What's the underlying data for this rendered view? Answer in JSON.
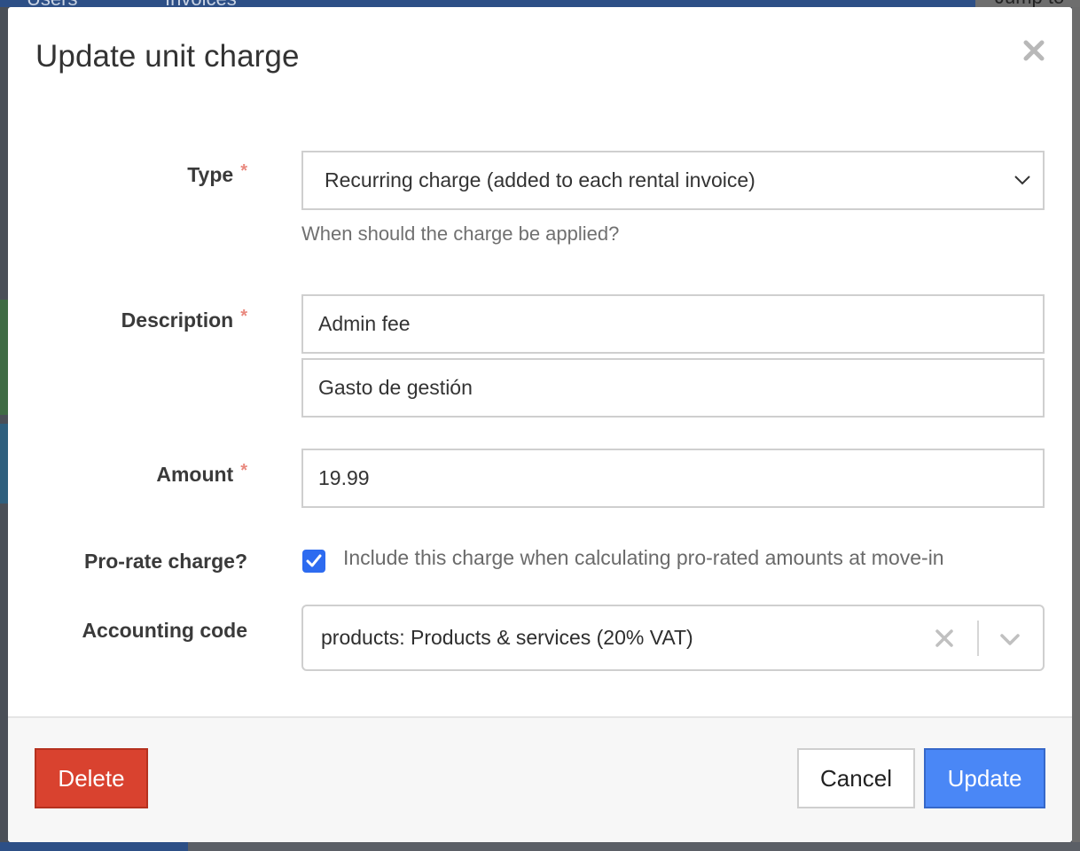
{
  "background": {
    "tabs": [
      "Users",
      "Invoices"
    ],
    "jump_label": "Jump to"
  },
  "modal": {
    "title": "Update unit charge",
    "close_icon": "close-icon"
  },
  "form": {
    "type": {
      "label": "Type",
      "required": "*",
      "value": "Recurring charge (added to each rental invoice)",
      "help": "When should the charge be applied?"
    },
    "description": {
      "label": "Description",
      "required": "*",
      "value_primary": "Admin fee",
      "value_secondary": "Gasto de gestión"
    },
    "amount": {
      "label": "Amount",
      "required": "*",
      "value": "19.99"
    },
    "prorate": {
      "label": "Pro-rate charge?",
      "checked": true,
      "checkbox_label": "Include this charge when calculating pro-rated amounts at move-in"
    },
    "accounting_code": {
      "label": "Accounting code",
      "value": "products: Products & services (20% VAT)"
    }
  },
  "footer": {
    "delete_label": "Delete",
    "cancel_label": "Cancel",
    "update_label": "Update"
  },
  "colors": {
    "delete": "#d9422f",
    "primary": "#4a87f6",
    "checkbox": "#2d6bf0",
    "required": "#e9897f"
  }
}
